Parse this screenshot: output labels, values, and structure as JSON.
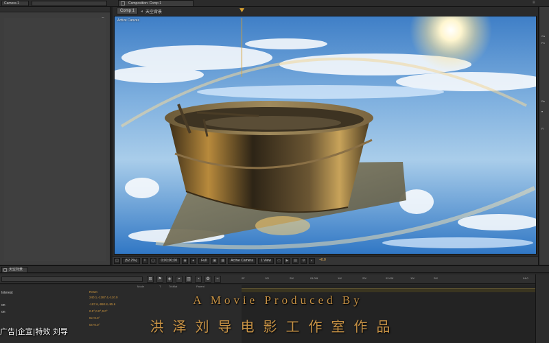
{
  "top": {
    "camera_label": "Camera 1",
    "comp_tab_label": "Composition: Comp 1"
  },
  "viewer": {
    "breadcrumb_active": "Comp 1",
    "breadcrumb_next": "天空背景",
    "canvas_label": "Active Canvas",
    "zoom": "(52.2%)",
    "timecode": "0;00;00;00",
    "resolution": "Full",
    "camera_view": "Active Camera",
    "view_layout": "1 View",
    "exposure": "+0.0"
  },
  "timeline": {
    "tab_label": "天空背景",
    "ruler_ticks": [
      "0F",
      "10f",
      "20f",
      "01:00f",
      "10f",
      "20f",
      "02:00f",
      "10f",
      "20f",
      "04:0"
    ],
    "col_heads": {
      "mode": "Mode",
      "t": "T",
      "trkmat": "TrkMat",
      "parent": "Parent"
    },
    "layers": [
      {
        "label": "Interest",
        "value": "Reset"
      },
      {
        "label": "",
        "value": "240.1,-1287.4,-110.0"
      },
      {
        "label": "on",
        "value": "-187.6,-950.8,-95.6"
      },
      {
        "label": "on",
        "value": "0.0°,0.0°,0.0°"
      },
      {
        "label": "",
        "value": "0x+0.0°"
      },
      {
        "label": "",
        "value": "0x+0.0°"
      }
    ]
  },
  "overlay": {
    "title": "A Movie Produced By",
    "studio_cn": "洪泽刘导电影工作室作品",
    "promo": "广告|企宣|特效 刘导"
  },
  "colors": {
    "ae_bg": "#1e1e1e",
    "panel": "#3d3d3d",
    "accent": "#d8a030",
    "title_gold": "#c79245"
  }
}
